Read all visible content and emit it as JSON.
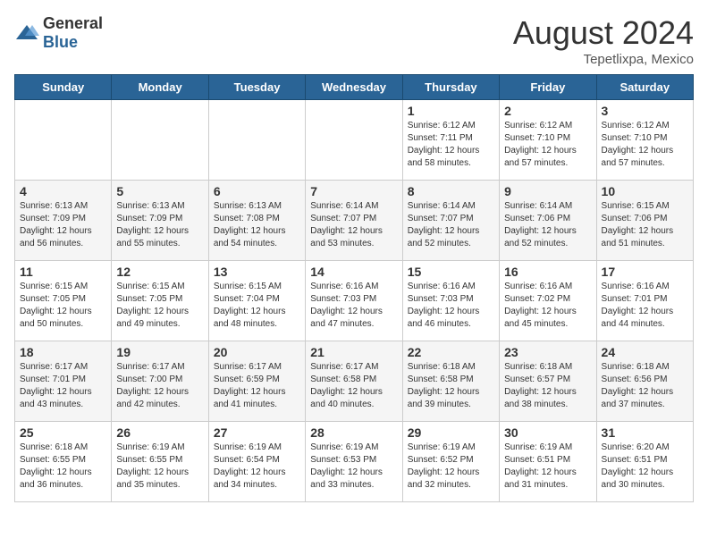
{
  "header": {
    "logo_general": "General",
    "logo_blue": "Blue",
    "title": "August 2024",
    "subtitle": "Tepetlixpa, Mexico"
  },
  "days_of_week": [
    "Sunday",
    "Monday",
    "Tuesday",
    "Wednesday",
    "Thursday",
    "Friday",
    "Saturday"
  ],
  "weeks": [
    [
      {
        "day": "",
        "info": ""
      },
      {
        "day": "",
        "info": ""
      },
      {
        "day": "",
        "info": ""
      },
      {
        "day": "",
        "info": ""
      },
      {
        "day": "1",
        "info": "Sunrise: 6:12 AM\nSunset: 7:11 PM\nDaylight: 12 hours\nand 58 minutes."
      },
      {
        "day": "2",
        "info": "Sunrise: 6:12 AM\nSunset: 7:10 PM\nDaylight: 12 hours\nand 57 minutes."
      },
      {
        "day": "3",
        "info": "Sunrise: 6:12 AM\nSunset: 7:10 PM\nDaylight: 12 hours\nand 57 minutes."
      }
    ],
    [
      {
        "day": "4",
        "info": "Sunrise: 6:13 AM\nSunset: 7:09 PM\nDaylight: 12 hours\nand 56 minutes."
      },
      {
        "day": "5",
        "info": "Sunrise: 6:13 AM\nSunset: 7:09 PM\nDaylight: 12 hours\nand 55 minutes."
      },
      {
        "day": "6",
        "info": "Sunrise: 6:13 AM\nSunset: 7:08 PM\nDaylight: 12 hours\nand 54 minutes."
      },
      {
        "day": "7",
        "info": "Sunrise: 6:14 AM\nSunset: 7:07 PM\nDaylight: 12 hours\nand 53 minutes."
      },
      {
        "day": "8",
        "info": "Sunrise: 6:14 AM\nSunset: 7:07 PM\nDaylight: 12 hours\nand 52 minutes."
      },
      {
        "day": "9",
        "info": "Sunrise: 6:14 AM\nSunset: 7:06 PM\nDaylight: 12 hours\nand 52 minutes."
      },
      {
        "day": "10",
        "info": "Sunrise: 6:15 AM\nSunset: 7:06 PM\nDaylight: 12 hours\nand 51 minutes."
      }
    ],
    [
      {
        "day": "11",
        "info": "Sunrise: 6:15 AM\nSunset: 7:05 PM\nDaylight: 12 hours\nand 50 minutes."
      },
      {
        "day": "12",
        "info": "Sunrise: 6:15 AM\nSunset: 7:05 PM\nDaylight: 12 hours\nand 49 minutes."
      },
      {
        "day": "13",
        "info": "Sunrise: 6:15 AM\nSunset: 7:04 PM\nDaylight: 12 hours\nand 48 minutes."
      },
      {
        "day": "14",
        "info": "Sunrise: 6:16 AM\nSunset: 7:03 PM\nDaylight: 12 hours\nand 47 minutes."
      },
      {
        "day": "15",
        "info": "Sunrise: 6:16 AM\nSunset: 7:03 PM\nDaylight: 12 hours\nand 46 minutes."
      },
      {
        "day": "16",
        "info": "Sunrise: 6:16 AM\nSunset: 7:02 PM\nDaylight: 12 hours\nand 45 minutes."
      },
      {
        "day": "17",
        "info": "Sunrise: 6:16 AM\nSunset: 7:01 PM\nDaylight: 12 hours\nand 44 minutes."
      }
    ],
    [
      {
        "day": "18",
        "info": "Sunrise: 6:17 AM\nSunset: 7:01 PM\nDaylight: 12 hours\nand 43 minutes."
      },
      {
        "day": "19",
        "info": "Sunrise: 6:17 AM\nSunset: 7:00 PM\nDaylight: 12 hours\nand 42 minutes."
      },
      {
        "day": "20",
        "info": "Sunrise: 6:17 AM\nSunset: 6:59 PM\nDaylight: 12 hours\nand 41 minutes."
      },
      {
        "day": "21",
        "info": "Sunrise: 6:17 AM\nSunset: 6:58 PM\nDaylight: 12 hours\nand 40 minutes."
      },
      {
        "day": "22",
        "info": "Sunrise: 6:18 AM\nSunset: 6:58 PM\nDaylight: 12 hours\nand 39 minutes."
      },
      {
        "day": "23",
        "info": "Sunrise: 6:18 AM\nSunset: 6:57 PM\nDaylight: 12 hours\nand 38 minutes."
      },
      {
        "day": "24",
        "info": "Sunrise: 6:18 AM\nSunset: 6:56 PM\nDaylight: 12 hours\nand 37 minutes."
      }
    ],
    [
      {
        "day": "25",
        "info": "Sunrise: 6:18 AM\nSunset: 6:55 PM\nDaylight: 12 hours\nand 36 minutes."
      },
      {
        "day": "26",
        "info": "Sunrise: 6:19 AM\nSunset: 6:55 PM\nDaylight: 12 hours\nand 35 minutes."
      },
      {
        "day": "27",
        "info": "Sunrise: 6:19 AM\nSunset: 6:54 PM\nDaylight: 12 hours\nand 34 minutes."
      },
      {
        "day": "28",
        "info": "Sunrise: 6:19 AM\nSunset: 6:53 PM\nDaylight: 12 hours\nand 33 minutes."
      },
      {
        "day": "29",
        "info": "Sunrise: 6:19 AM\nSunset: 6:52 PM\nDaylight: 12 hours\nand 32 minutes."
      },
      {
        "day": "30",
        "info": "Sunrise: 6:19 AM\nSunset: 6:51 PM\nDaylight: 12 hours\nand 31 minutes."
      },
      {
        "day": "31",
        "info": "Sunrise: 6:20 AM\nSunset: 6:51 PM\nDaylight: 12 hours\nand 30 minutes."
      }
    ]
  ]
}
